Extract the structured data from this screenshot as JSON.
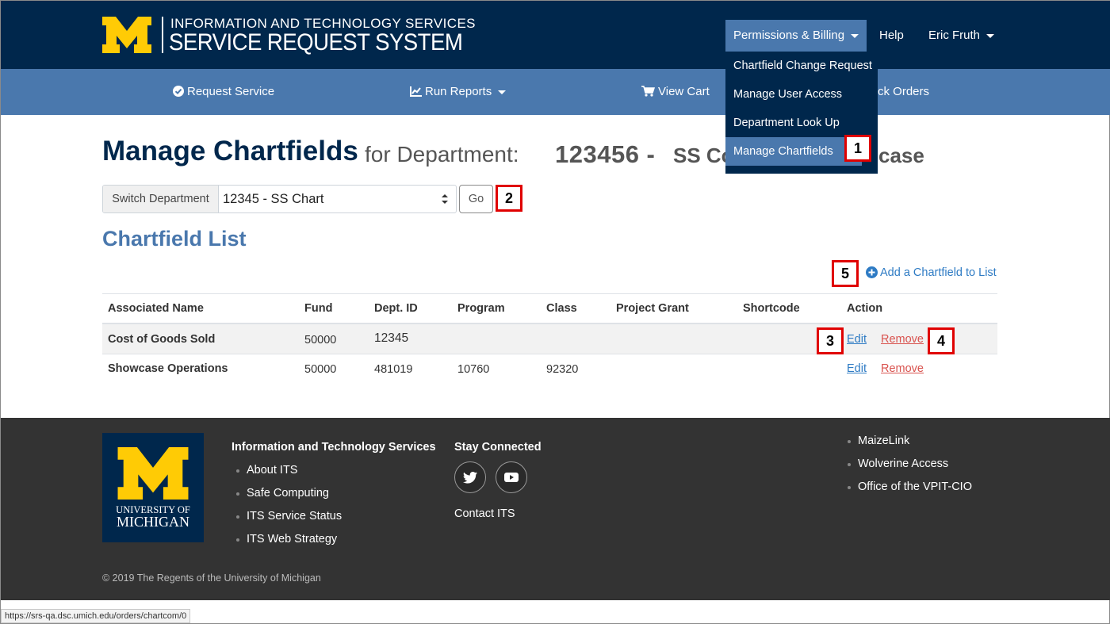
{
  "header": {
    "brand_top": "INFORMATION AND TECHNOLOGY SERVICES",
    "brand_bottom": "SERVICE REQUEST SYSTEM",
    "nav": {
      "permissions": "Permissions & Billing",
      "help": "Help",
      "user": "Eric Fruth"
    }
  },
  "subnav": {
    "request_service": "Request Service",
    "run_reports": "Run Reports",
    "view_cart": "View Cart",
    "track_orders": "ck Orders"
  },
  "dropdown": {
    "items": [
      "Chartfield Change Request",
      "Manage User Access",
      "Department Look Up",
      "Manage Chartfields"
    ]
  },
  "callouts": [
    "1",
    "2",
    "3",
    "4",
    "5"
  ],
  "page": {
    "title": "Manage Chartfields",
    "title_sub": "for Department:",
    "dept_code": "123456 -",
    "dept_name_a": "SS Co",
    "dept_name_b": "case"
  },
  "switch": {
    "label": "Switch Department",
    "selected": "12345 - SS Chart",
    "go": "Go"
  },
  "list": {
    "title": "Chartfield List",
    "add_link": "Add a Chartfield to List",
    "columns": [
      "Associated Name",
      "Fund",
      "Dept. ID",
      "Program",
      "Class",
      "Project Grant",
      "Shortcode",
      "Action"
    ],
    "rows": [
      {
        "name": "Cost of Goods Sold",
        "fund": "50000",
        "dept": "12345",
        "program": "",
        "class": "",
        "grant": "",
        "shortcode": "",
        "edit": "Edit",
        "remove": "Remove"
      },
      {
        "name": "Showcase Operations",
        "fund": "50000",
        "dept": "481019",
        "program": "10760",
        "class": "92320",
        "grant": "",
        "shortcode": "",
        "edit": "Edit",
        "remove": "Remove"
      }
    ]
  },
  "footer": {
    "logo_line1": "UNIVERSITY OF",
    "logo_line2": "MICHIGAN",
    "its_heading": "Information and Technology Services",
    "its_links": [
      "About ITS",
      "Safe Computing",
      "ITS Service Status",
      "ITS Web Strategy"
    ],
    "stay_heading": "Stay Connected",
    "contact": "Contact ITS",
    "right_links": [
      "MaizeLink",
      "Wolverine Access",
      "Office of the VPIT-CIO"
    ],
    "copyright": "© 2019 The Regents of the University of Michigan"
  },
  "statusbar": "https://srs-qa.dsc.umich.edu/orders/chartcom/0",
  "colors": {
    "navy": "#00274c",
    "blue": "#4a78ad",
    "maize": "#ffcb05",
    "callout_red": "#e00000",
    "link": "#2e7bc4",
    "remove": "#d9534f"
  }
}
